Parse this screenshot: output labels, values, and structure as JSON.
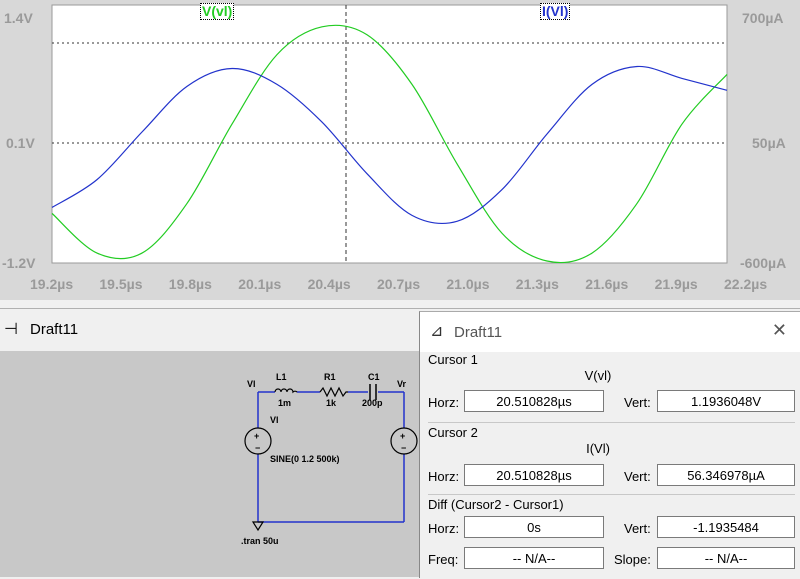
{
  "waveform": {
    "trace_v_label": "V(vl)",
    "trace_i_label": "I(Vl)",
    "trace_v_color": "#22cc22",
    "trace_i_color": "#2233cc",
    "y_left_ticks": [
      "1.4V",
      "0.1V",
      "-1.2V"
    ],
    "y_right_ticks": [
      "700µA",
      "50µA",
      "-600µA"
    ],
    "x_ticks": [
      "19.2µs",
      "19.5µs",
      "19.8µs",
      "20.1µs",
      "20.4µs",
      "20.7µs",
      "21.0µs",
      "21.3µs",
      "21.6µs",
      "21.9µs",
      "22.2µs"
    ]
  },
  "chart_data": {
    "type": "line",
    "x": [
      19.2,
      19.4,
      19.6,
      19.8,
      20.0,
      20.2,
      20.4,
      20.6,
      20.8,
      21.0,
      21.2,
      21.4,
      21.6,
      21.8,
      22.0,
      22.2
    ],
    "series": [
      {
        "name": "V(vl)",
        "values": [
          -0.7,
          -1.1,
          -1.1,
          -0.6,
          0.2,
          0.9,
          1.18,
          1.1,
          0.6,
          -0.2,
          -0.9,
          -1.18,
          -1.1,
          -0.6,
          0.2,
          0.7
        ]
      },
      {
        "name": "I(Vl)",
        "values": [
          -320,
          -180,
          60,
          290,
          380,
          300,
          110,
          -150,
          -360,
          -390,
          -230,
          50,
          300,
          390,
          330,
          270
        ]
      }
    ],
    "xlabel": "",
    "ylabel": "",
    "xlim": [
      19.2,
      22.2
    ],
    "ylim_left": [
      -1.2,
      1.4
    ],
    "ylim_right": [
      -600,
      700
    ]
  },
  "schematic": {
    "title": "Draft11",
    "components": {
      "l1_name": "L1",
      "l1_value": "1m",
      "r1_name": "R1",
      "r1_value": "1k",
      "c1_name": "C1",
      "c1_value": "200p",
      "node_vl": "Vl",
      "node_vr": "Vr",
      "source_name": "Vl",
      "source_value": "SINE(0 1.2 500k)",
      "directive": ".tran 50u"
    }
  },
  "cursor_dialog": {
    "title": "Draft11",
    "cursor1": {
      "label": "Cursor 1",
      "signal": "V(vl)",
      "horz_label": "Horz:",
      "horz": "20.510828µs",
      "vert_label": "Vert:",
      "vert": "1.1936048V"
    },
    "cursor2": {
      "label": "Cursor 2",
      "signal": "I(Vl)",
      "horz_label": "Horz:",
      "horz": "20.510828µs",
      "vert_label": "Vert:",
      "vert": "56.346978µA"
    },
    "diff": {
      "label": "Diff (Cursor2 - Cursor1)",
      "horz_label": "Horz:",
      "horz": "0s",
      "vert_label": "Vert:",
      "vert": "-1.1935484",
      "freq_label": "Freq:",
      "freq": "-- N/A--",
      "slope_label": "Slope:",
      "slope": "-- N/A--"
    }
  }
}
